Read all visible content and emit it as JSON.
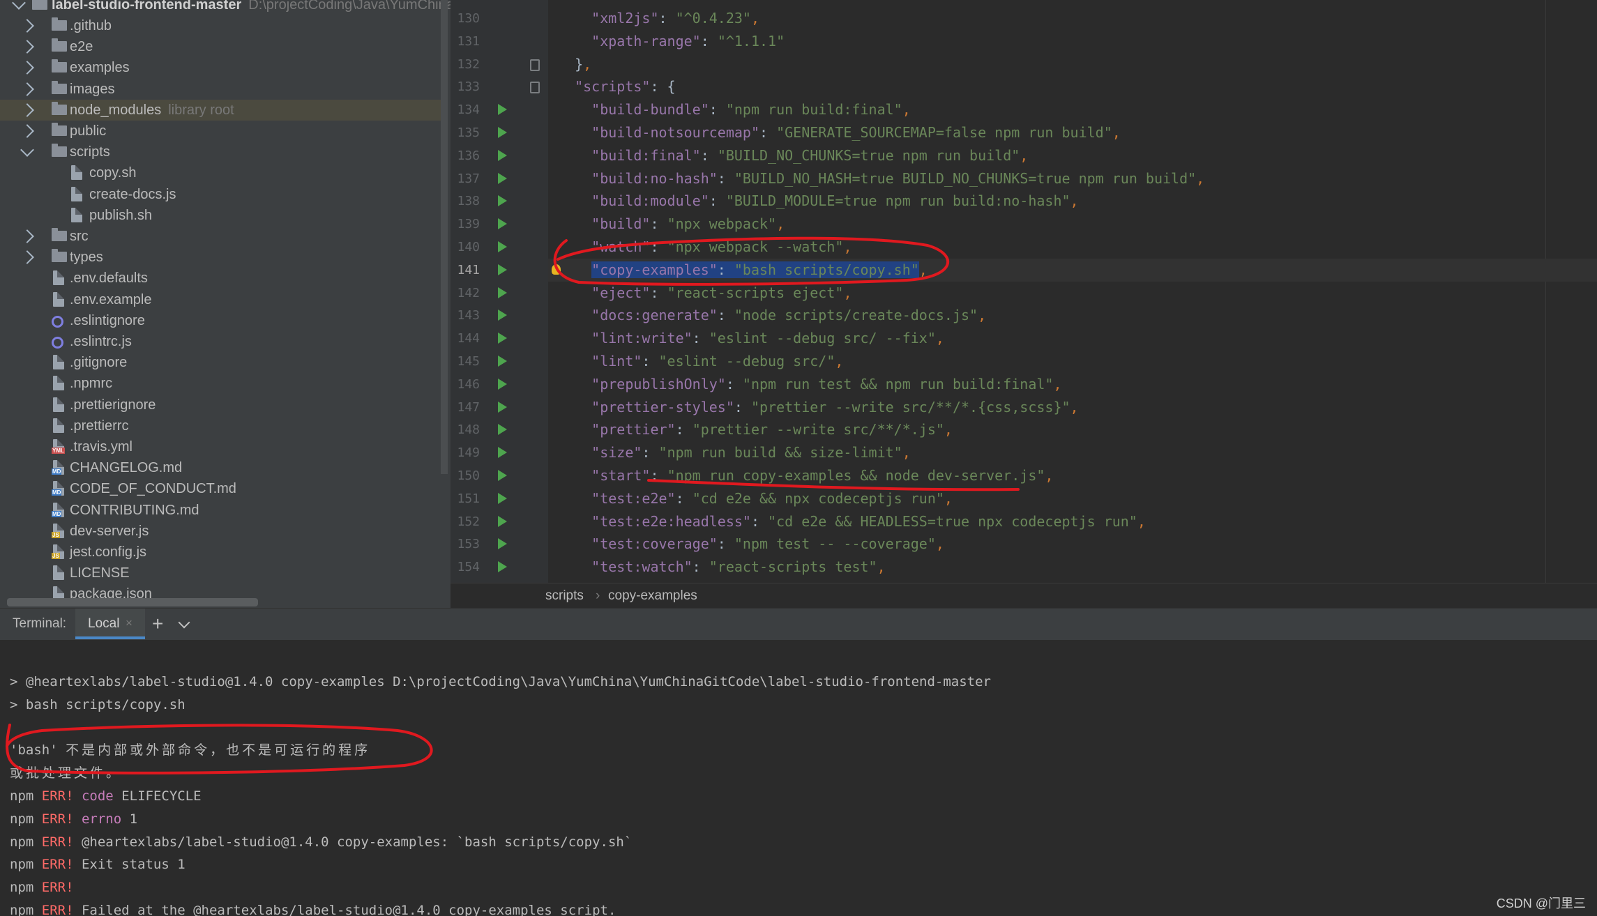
{
  "project_tree": {
    "root_name": "label-studio-frontend-master",
    "root_path": "D:\\projectCoding\\Java\\YumChina\\",
    "items": [
      {
        "label": "github",
        "kind": "folder",
        "expanded": false,
        "depth": 1,
        "prefix": "."
      },
      {
        "label": "e2e",
        "kind": "folder",
        "expanded": false,
        "depth": 1
      },
      {
        "label": "examples",
        "kind": "folder",
        "expanded": false,
        "depth": 1
      },
      {
        "label": "images",
        "kind": "folder",
        "expanded": false,
        "depth": 1
      },
      {
        "label": "node_modules",
        "hint": "library root",
        "kind": "folder",
        "expanded": false,
        "depth": 1,
        "selected": true
      },
      {
        "label": "public",
        "kind": "folder",
        "expanded": false,
        "depth": 1
      },
      {
        "label": "scripts",
        "kind": "folder",
        "expanded": true,
        "depth": 1
      },
      {
        "label": "copy.sh",
        "kind": "file",
        "depth": 2,
        "icon": "shell-script-icon"
      },
      {
        "label": "create-docs.js",
        "kind": "file",
        "depth": 2,
        "icon": "js-file-icon"
      },
      {
        "label": "publish.sh",
        "kind": "file",
        "depth": 2,
        "icon": "shell-script-icon"
      },
      {
        "label": "src",
        "kind": "folder",
        "expanded": false,
        "depth": 1
      },
      {
        "label": "types",
        "kind": "folder",
        "expanded": false,
        "depth": 1
      },
      {
        "label": ".env.defaults",
        "kind": "file",
        "depth": 1,
        "icon": "text-file-icon"
      },
      {
        "label": ".env.example",
        "kind": "file",
        "depth": 1,
        "icon": "text-file-icon"
      },
      {
        "label": ".eslintignore",
        "kind": "ring",
        "depth": 1,
        "icon": "eslint-icon"
      },
      {
        "label": ".eslintrc.js",
        "kind": "ring",
        "depth": 1,
        "icon": "eslint-icon"
      },
      {
        "label": ".gitignore",
        "kind": "file",
        "depth": 1,
        "icon": "gitignore-file-icon"
      },
      {
        "label": ".npmrc",
        "kind": "file",
        "depth": 1,
        "icon": "text-file-icon"
      },
      {
        "label": ".prettierignore",
        "kind": "file",
        "depth": 1,
        "icon": "text-file-icon"
      },
      {
        "label": ".prettierrc",
        "kind": "file",
        "depth": 1,
        "icon": "config-file-icon"
      },
      {
        "label": ".travis.yml",
        "kind": "file",
        "depth": 1,
        "icon": "yaml-file-icon",
        "badge": "YML",
        "badge_color": "#c94f4f"
      },
      {
        "label": "CHANGELOG.md",
        "kind": "file",
        "depth": 1,
        "icon": "markdown-file-icon",
        "badge": "MD",
        "badge_color": "#3d7bc6"
      },
      {
        "label": "CODE_OF_CONDUCT.md",
        "kind": "file",
        "depth": 1,
        "icon": "markdown-file-icon",
        "badge": "MD",
        "badge_color": "#3d7bc6"
      },
      {
        "label": "CONTRIBUTING.md",
        "kind": "file",
        "depth": 1,
        "icon": "markdown-file-icon",
        "badge": "MD",
        "badge_color": "#3d7bc6"
      },
      {
        "label": "dev-server.js",
        "kind": "file",
        "depth": 1,
        "icon": "js-file-icon",
        "badge": "JS",
        "badge_color": "#c9a227"
      },
      {
        "label": "jest.config.js",
        "kind": "file",
        "depth": 1,
        "icon": "js-file-icon",
        "badge": "JS",
        "badge_color": "#c9a227"
      },
      {
        "label": "LICENSE",
        "kind": "file",
        "depth": 1,
        "icon": "text-file-icon"
      },
      {
        "label": "package.json",
        "kind": "file",
        "depth": 1,
        "icon": "json-file-icon"
      }
    ]
  },
  "editor": {
    "current_line": 141,
    "lines": [
      {
        "num": 130,
        "tokens": [
          [
            "i",
            "    "
          ],
          [
            "k",
            "\"xml2js\""
          ],
          [
            "t",
            ": "
          ],
          [
            "s",
            "\"^0.4.23\""
          ],
          [
            "p",
            ","
          ]
        ]
      },
      {
        "num": 131,
        "tokens": [
          [
            "i",
            "    "
          ],
          [
            "k",
            "\"xpath-range\""
          ],
          [
            "t",
            ": "
          ],
          [
            "s",
            "\"^1.1.1\""
          ]
        ]
      },
      {
        "num": 132,
        "tokens": [
          [
            "i",
            "  "
          ],
          [
            "t",
            "}"
          ],
          [
            "p",
            ","
          ]
        ],
        "fold": true
      },
      {
        "num": 133,
        "tokens": [
          [
            "i",
            "  "
          ],
          [
            "k",
            "\"scripts\""
          ],
          [
            "t",
            ": {"
          ]
        ],
        "fold": true
      },
      {
        "num": 134,
        "run": true,
        "tokens": [
          [
            "i",
            "    "
          ],
          [
            "k",
            "\"build-bundle\""
          ],
          [
            "t",
            ": "
          ],
          [
            "s",
            "\"npm run build:final\""
          ],
          [
            "p",
            ","
          ]
        ]
      },
      {
        "num": 135,
        "run": true,
        "tokens": [
          [
            "i",
            "    "
          ],
          [
            "k",
            "\"build-notsourcemap\""
          ],
          [
            "t",
            ": "
          ],
          [
            "s",
            "\"GENERATE_SOURCEMAP=false npm run build\""
          ],
          [
            "p",
            ","
          ]
        ]
      },
      {
        "num": 136,
        "run": true,
        "tokens": [
          [
            "i",
            "    "
          ],
          [
            "k",
            "\"build:final\""
          ],
          [
            "t",
            ": "
          ],
          [
            "s",
            "\"BUILD_NO_CHUNKS=true npm run build\""
          ],
          [
            "p",
            ","
          ]
        ]
      },
      {
        "num": 137,
        "run": true,
        "tokens": [
          [
            "i",
            "    "
          ],
          [
            "k",
            "\"build:no-hash\""
          ],
          [
            "t",
            ": "
          ],
          [
            "s",
            "\"BUILD_NO_HASH=true BUILD_NO_CHUNKS=true npm run build\""
          ],
          [
            "p",
            ","
          ]
        ]
      },
      {
        "num": 138,
        "run": true,
        "tokens": [
          [
            "i",
            "    "
          ],
          [
            "k",
            "\"build:module\""
          ],
          [
            "t",
            ": "
          ],
          [
            "s",
            "\"BUILD_MODULE=true npm run build:no-hash\""
          ],
          [
            "p",
            ","
          ]
        ]
      },
      {
        "num": 139,
        "run": true,
        "tokens": [
          [
            "i",
            "    "
          ],
          [
            "k",
            "\"build\""
          ],
          [
            "t",
            ": "
          ],
          [
            "s",
            "\"npx webpack\""
          ],
          [
            "p",
            ","
          ]
        ]
      },
      {
        "num": 140,
        "run": true,
        "tokens": [
          [
            "i",
            "    "
          ],
          [
            "k",
            "\"watch\""
          ],
          [
            "t",
            ": "
          ],
          [
            "s",
            "\"npx webpack --watch\""
          ],
          [
            "p",
            ","
          ]
        ]
      },
      {
        "num": 141,
        "run": true,
        "bulb": true,
        "tokens": [
          [
            "i",
            "    "
          ],
          [
            "ks",
            "\"copy-examples\""
          ],
          [
            "ts",
            ": "
          ],
          [
            "ss",
            "\"bash scripts/copy.sh\""
          ],
          [
            "p",
            ","
          ]
        ]
      },
      {
        "num": 142,
        "run": true,
        "tokens": [
          [
            "i",
            "    "
          ],
          [
            "k",
            "\"eject\""
          ],
          [
            "t",
            ": "
          ],
          [
            "s",
            "\"react-scripts eject\""
          ],
          [
            "p",
            ","
          ]
        ]
      },
      {
        "num": 143,
        "run": true,
        "tokens": [
          [
            "i",
            "    "
          ],
          [
            "k",
            "\"docs:generate\""
          ],
          [
            "t",
            ": "
          ],
          [
            "s",
            "\"node scripts/create-docs.js\""
          ],
          [
            "p",
            ","
          ]
        ]
      },
      {
        "num": 144,
        "run": true,
        "tokens": [
          [
            "i",
            "    "
          ],
          [
            "k",
            "\"lint:write\""
          ],
          [
            "t",
            ": "
          ],
          [
            "s",
            "\"eslint --debug src/ --fix\""
          ],
          [
            "p",
            ","
          ]
        ]
      },
      {
        "num": 145,
        "run": true,
        "tokens": [
          [
            "i",
            "    "
          ],
          [
            "k",
            "\"lint\""
          ],
          [
            "t",
            ": "
          ],
          [
            "s",
            "\"eslint --debug src/\""
          ],
          [
            "p",
            ","
          ]
        ]
      },
      {
        "num": 146,
        "run": true,
        "tokens": [
          [
            "i",
            "    "
          ],
          [
            "k",
            "\"prepublishOnly\""
          ],
          [
            "t",
            ": "
          ],
          [
            "s",
            "\"npm run test && npm run build:final\""
          ],
          [
            "p",
            ","
          ]
        ]
      },
      {
        "num": 147,
        "run": true,
        "tokens": [
          [
            "i",
            "    "
          ],
          [
            "k",
            "\"prettier-styles\""
          ],
          [
            "t",
            ": "
          ],
          [
            "s",
            "\"prettier --write src/**/*.{css,scss}\""
          ],
          [
            "p",
            ","
          ]
        ]
      },
      {
        "num": 148,
        "run": true,
        "tokens": [
          [
            "i",
            "    "
          ],
          [
            "k",
            "\"prettier\""
          ],
          [
            "t",
            ": "
          ],
          [
            "s",
            "\"prettier --write src/**/*.js\""
          ],
          [
            "p",
            ","
          ]
        ]
      },
      {
        "num": 149,
        "run": true,
        "tokens": [
          [
            "i",
            "    "
          ],
          [
            "k",
            "\"size\""
          ],
          [
            "t",
            ": "
          ],
          [
            "s",
            "\"npm run build && size-limit\""
          ],
          [
            "p",
            ","
          ]
        ]
      },
      {
        "num": 150,
        "run": true,
        "tokens": [
          [
            "i",
            "    "
          ],
          [
            "k",
            "\"start\""
          ],
          [
            "t",
            ": "
          ],
          [
            "s",
            "\"npm run copy-examples && node dev-server.js\""
          ],
          [
            "p",
            ","
          ]
        ]
      },
      {
        "num": 151,
        "run": true,
        "tokens": [
          [
            "i",
            "    "
          ],
          [
            "k",
            "\"test:e2e\""
          ],
          [
            "t",
            ": "
          ],
          [
            "s",
            "\"cd e2e && npx codeceptjs run\""
          ],
          [
            "p",
            ","
          ]
        ]
      },
      {
        "num": 152,
        "run": true,
        "tokens": [
          [
            "i",
            "    "
          ],
          [
            "k",
            "\"test:e2e:headless\""
          ],
          [
            "t",
            ": "
          ],
          [
            "s",
            "\"cd e2e && HEADLESS=true npx codeceptjs run\""
          ],
          [
            "p",
            ","
          ]
        ]
      },
      {
        "num": 153,
        "run": true,
        "tokens": [
          [
            "i",
            "    "
          ],
          [
            "k",
            "\"test:coverage\""
          ],
          [
            "t",
            ": "
          ],
          [
            "s",
            "\"npm test -- --coverage\""
          ],
          [
            "p",
            ","
          ]
        ]
      },
      {
        "num": 154,
        "run": true,
        "tokens": [
          [
            "i",
            "    "
          ],
          [
            "k",
            "\"test:watch\""
          ],
          [
            "t",
            ": "
          ],
          [
            "s",
            "\"react-scripts test\""
          ],
          [
            "p",
            ","
          ]
        ]
      }
    ]
  },
  "breadcrumbs": {
    "first": "scripts",
    "separator": "›",
    "second": "copy-examples"
  },
  "terminal": {
    "title": "Terminal:",
    "tab_label": "Local",
    "tab_close": "×",
    "add_label": "+",
    "lines": [
      [
        [
          "t",
          "> @heartexlabs/label-studio@1.4.0 copy-examples D:\\projectCoding\\Java\\YumChina\\YumChinaGitCode\\label-studio-frontend-master"
        ]
      ],
      [
        [
          "t",
          "> bash scripts/copy.sh"
        ]
      ],
      [
        [
          "t",
          ""
        ]
      ],
      [
        [
          "t",
          "'bash' "
        ],
        [
          "c",
          "不是内部或外部命令，也不是可运行的程序"
        ]
      ],
      [
        [
          "c",
          "或批处理文件。"
        ]
      ],
      [
        [
          "t",
          "npm "
        ],
        [
          "e",
          "ERR!"
        ],
        [
          "t",
          " "
        ],
        [
          "y",
          "code"
        ],
        [
          "t",
          " ELIFECYCLE"
        ]
      ],
      [
        [
          "t",
          "npm "
        ],
        [
          "e",
          "ERR!"
        ],
        [
          "t",
          " "
        ],
        [
          "y",
          "errno"
        ],
        [
          "t",
          " 1"
        ]
      ],
      [
        [
          "t",
          "npm "
        ],
        [
          "e",
          "ERR!"
        ],
        [
          "t",
          " @heartexlabs/label-studio@1.4.0 copy-examples: `bash scripts/copy.sh`"
        ]
      ],
      [
        [
          "t",
          "npm "
        ],
        [
          "e",
          "ERR!"
        ],
        [
          "t",
          " Exit status 1"
        ]
      ],
      [
        [
          "t",
          "npm "
        ],
        [
          "e",
          "ERR!"
        ]
      ],
      [
        [
          "t",
          "npm "
        ],
        [
          "e",
          "ERR!"
        ],
        [
          "t",
          " Failed at the @heartexlabs/label-studio@1.4.0 copy-examples script."
        ]
      ]
    ]
  },
  "watermark": "CSDN @门里三",
  "colors": {
    "annotation_red": "#e0191f",
    "selection": "#214283",
    "run_green": "#4ea54e",
    "error_red": "#ff6b68"
  }
}
